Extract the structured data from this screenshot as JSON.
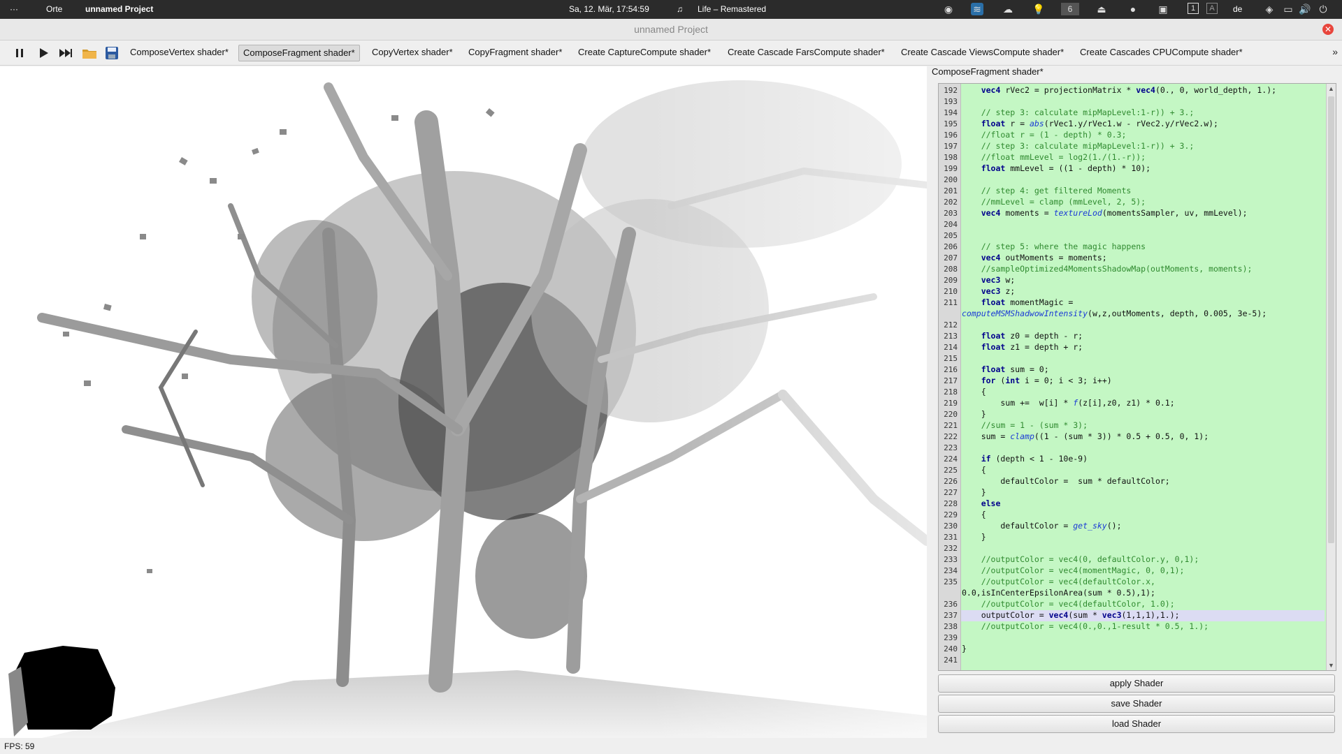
{
  "system_bar": {
    "menu_dots": "···",
    "places": "Orte",
    "app_name": "unnamed Project",
    "datetime": "Sa, 12. Mär, 17:54:59",
    "now_playing": "Life – Remastered",
    "workspace_number": "6",
    "keyboard_layout": "de",
    "tray_badge_1": "1",
    "tray_badge_a": "A"
  },
  "window": {
    "title": "unnamed Project",
    "close_icon": "close-icon"
  },
  "toolbar": {
    "pause_icon": "pause-icon",
    "play_icon": "play-icon",
    "skip_icon": "skip-forward-icon",
    "open_icon": "folder-icon",
    "save_icon": "save-icon",
    "tabs": [
      {
        "label": "ComposeVertex shader*",
        "active": false
      },
      {
        "label": "ComposeFragment shader*",
        "active": true
      },
      {
        "label": "CopyVertex shader*",
        "active": false
      },
      {
        "label": "CopyFragment shader*",
        "active": false
      },
      {
        "label": "Create CaptureCompute shader*",
        "active": false
      },
      {
        "label": "Create Cascade FarsCompute shader*",
        "active": false
      },
      {
        "label": "Create Cascade ViewsCompute shader*",
        "active": false
      },
      {
        "label": "Create Cascades CPUCompute shader*",
        "active": false
      }
    ],
    "more": "»"
  },
  "editor": {
    "title": "ComposeFragment shader*",
    "lines": [
      {
        "n": "192",
        "t": "    vec4 rVec2 = projectionMatrix * vec4(0., 0, world_depth, 1.);"
      },
      {
        "n": "193",
        "t": ""
      },
      {
        "n": "194",
        "t": "    // step 3: calculate mipMapLevel:1-r)) + 3.;"
      },
      {
        "n": "195",
        "t": "    float r = abs(rVec1.y/rVec1.w - rVec2.y/rVec2.w);"
      },
      {
        "n": "196",
        "t": "    //float r = (1 - depth) * 0.3;"
      },
      {
        "n": "197",
        "t": "    // step 3: calculate mipMapLevel:1-r)) + 3.;"
      },
      {
        "n": "198",
        "t": "    //float mmLevel = log2(1./(1.-r));"
      },
      {
        "n": "199",
        "t": "    float mmLevel = ((1 - depth) * 10);"
      },
      {
        "n": "200",
        "t": ""
      },
      {
        "n": "201",
        "t": "    // step 4: get filtered Moments"
      },
      {
        "n": "202",
        "t": "    //mmLevel = clamp (mmLevel, 2, 5);"
      },
      {
        "n": "203",
        "t": "    vec4 moments = textureLod(momentsSampler, uv, mmLevel);"
      },
      {
        "n": "204",
        "t": ""
      },
      {
        "n": "205",
        "t": ""
      },
      {
        "n": "206",
        "t": "    // step 5: where the magic happens"
      },
      {
        "n": "207",
        "t": "    vec4 outMoments = moments;"
      },
      {
        "n": "208",
        "t": "    //sampleOptimized4MomentsShadowMap(outMoments, moments);"
      },
      {
        "n": "209",
        "t": "    vec3 w;"
      },
      {
        "n": "210",
        "t": "    vec3 z;"
      },
      {
        "n": "211",
        "t": "    float momentMagic ="
      },
      {
        "n": "",
        "t": "computeMSMShadwowIntensity(w,z,outMoments, depth, 0.005, 3e-5);"
      },
      {
        "n": "212",
        "t": ""
      },
      {
        "n": "213",
        "t": "    float z0 = depth - r;"
      },
      {
        "n": "214",
        "t": "    float z1 = depth + r;"
      },
      {
        "n": "215",
        "t": ""
      },
      {
        "n": "216",
        "t": "    float sum = 0;"
      },
      {
        "n": "217",
        "t": "    for (int i = 0; i < 3; i++)"
      },
      {
        "n": "218",
        "t": "    {"
      },
      {
        "n": "219",
        "t": "        sum +=  w[i] * f(z[i],z0, z1) * 0.1;"
      },
      {
        "n": "220",
        "t": "    }"
      },
      {
        "n": "221",
        "t": "    //sum = 1 - (sum * 3);"
      },
      {
        "n": "222",
        "t": "    sum = clamp((1 - (sum * 3)) * 0.5 + 0.5, 0, 1);"
      },
      {
        "n": "223",
        "t": ""
      },
      {
        "n": "224",
        "t": "    if (depth < 1 - 10e-9)"
      },
      {
        "n": "225",
        "t": "    {"
      },
      {
        "n": "226",
        "t": "        defaultColor =  sum * defaultColor;"
      },
      {
        "n": "227",
        "t": "    }"
      },
      {
        "n": "228",
        "t": "    else"
      },
      {
        "n": "229",
        "t": "    {"
      },
      {
        "n": "230",
        "t": "        defaultColor = get_sky();"
      },
      {
        "n": "231",
        "t": "    }"
      },
      {
        "n": "232",
        "t": ""
      },
      {
        "n": "233",
        "t": "    //outputColor = vec4(0, defaultColor.y, 0,1);"
      },
      {
        "n": "234",
        "t": "    //outputColor = vec4(momentMagic, 0, 0,1);"
      },
      {
        "n": "235",
        "t": "    //outputColor = vec4(defaultColor.x,"
      },
      {
        "n": "",
        "t": "0.0,isInCenterEpsilonArea(sum * 0.5),1);"
      },
      {
        "n": "236",
        "t": "    //outputColor = vec4(defaultColor, 1.0);"
      },
      {
        "n": "237",
        "t": "    outputColor = vec4(sum * vec3(1,1,1),1.);"
      },
      {
        "n": "238",
        "t": "    //outputColor = vec4(0.,0.,1-result * 0.5, 1.);"
      },
      {
        "n": "239",
        "t": ""
      },
      {
        "n": "240",
        "t": "}"
      },
      {
        "n": "241",
        "t": ""
      }
    ],
    "highlighted_line": "237"
  },
  "buttons": {
    "apply": "apply Shader",
    "save": "save Shader",
    "load": "load Shader"
  },
  "status": {
    "fps": "FPS: 59"
  }
}
